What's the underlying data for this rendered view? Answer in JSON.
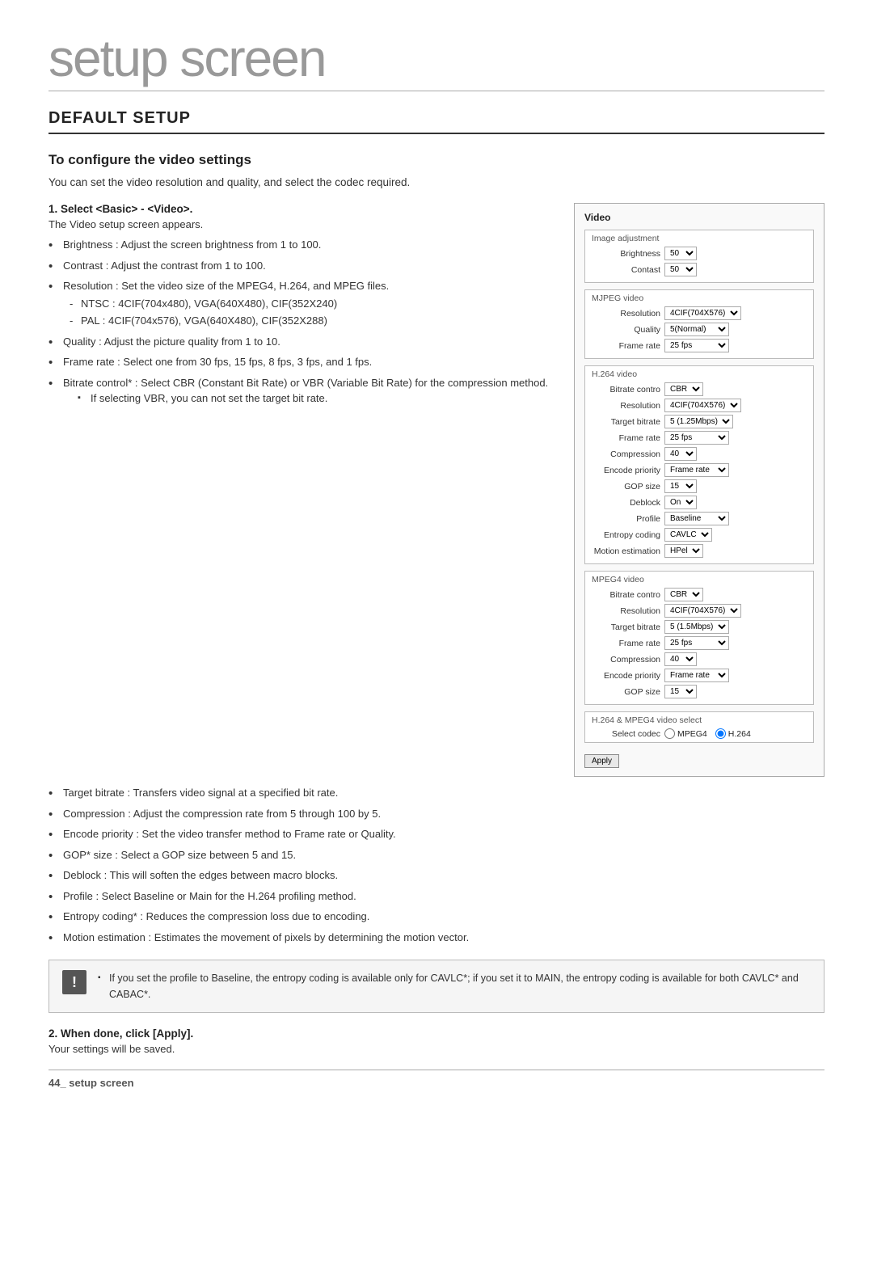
{
  "page": {
    "title": "setup screen",
    "section": "DEFAULT SETUP",
    "subheading": "To configure the video settings",
    "intro": "You can set the video resolution and quality, and select the codec required.",
    "footer": "44_ setup screen"
  },
  "step1": {
    "label": "Select <Basic> - <Video>.",
    "sub": "The Video setup screen appears.",
    "bullets": [
      "Brightness : Adjust the screen brightness from 1 to 100.",
      "Contrast : Adjust the contrast from 1 to 100.",
      "Resolution : Set the video size of the MPEG4, H.264, and MPEG files.",
      "Quality : Adjust the picture quality from 1 to 10.",
      "Frame rate : Select one from 30 fps, 15 fps, 8 fps, 3 fps, and 1 fps.",
      "Bitrate control* : Select CBR (Constant Bit Rate) or VBR (Variable Bit Rate) for the compression method.",
      "Target bitrate : Transfers video signal at a specified bit rate.",
      "Compression : Adjust the compression rate from 5 through 100 by 5.",
      "Encode priority :  Set the video transfer method to Frame rate or Quality.",
      "GOP* size : Select a GOP size between 5 and 15.",
      "Deblock : This will soften the edges between macro blocks.",
      "Profile : Select Baseline or Main for the H.264 profiling method.",
      "Entropy coding* : Reduces the compression loss due to encoding.",
      "Motion estimation : Estimates the movement of pixels by determining the motion vector."
    ],
    "resolution_sub": [
      "NTSC : 4CIF(704x480), VGA(640X480), CIF(352X240)",
      "PAL : 4CIF(704x576), VGA(640X480), CIF(352X288)"
    ],
    "vbr_note": "If selecting VBR, you can not set the target bit rate."
  },
  "video_panel": {
    "title": "Video",
    "groups": {
      "image_adjustment": {
        "label": "Image adjustment",
        "rows": [
          {
            "label": "Brightness",
            "value": "50"
          },
          {
            "label": "Contast",
            "value": "50"
          }
        ]
      },
      "mjpeg": {
        "label": "MJPEG video",
        "rows": [
          {
            "label": "Resolution",
            "value": "4CIF(704X576)"
          },
          {
            "label": "Quality",
            "value": "5(Normal)"
          },
          {
            "label": "Frame rate",
            "value": "25 fps"
          }
        ]
      },
      "h264": {
        "label": "H.264 video",
        "rows": [
          {
            "label": "Bitrate contro",
            "value": "CBR"
          },
          {
            "label": "Resolution",
            "value": "4CIF(704X576)"
          },
          {
            "label": "Target bitrate",
            "value": "5 (1.25Mbps)"
          },
          {
            "label": "Frame rate",
            "value": "25 fps"
          },
          {
            "label": "Compression",
            "value": "40"
          },
          {
            "label": "Encode priority",
            "value": "Frame rate"
          },
          {
            "label": "GOP size",
            "value": "15"
          },
          {
            "label": "Deblock",
            "value": "On"
          },
          {
            "label": "Profile",
            "value": "Baseline"
          },
          {
            "label": "Entropy coding",
            "value": "CAVLC"
          },
          {
            "label": "Motion estimation",
            "value": "HPel"
          }
        ]
      },
      "mpeg4": {
        "label": "MPEG4 video",
        "rows": [
          {
            "label": "Bitrate contro",
            "value": "CBR"
          },
          {
            "label": "Resolution",
            "value": "4CIF(704X576)"
          },
          {
            "label": "Target bitrate",
            "value": "5 (1.5Mbps)"
          },
          {
            "label": "Frame rate",
            "value": "25 fps"
          },
          {
            "label": "Compression",
            "value": "40"
          },
          {
            "label": "Encode priority",
            "value": "Frame rate"
          },
          {
            "label": "GOP size",
            "value": "15"
          }
        ]
      },
      "codec_select": {
        "label": "H.264 & MPEG4 video select",
        "label_text": "Select codec",
        "options": [
          "MPEG4",
          "H.264"
        ],
        "selected": "H.264"
      }
    },
    "apply_button": "Apply"
  },
  "warning": {
    "icon": "!",
    "text": "If you set the profile to Baseline, the entropy coding is available only for CAVLC*; if you set it to MAIN, the entropy coding is available for both CAVLC* and CABAC*."
  },
  "step2": {
    "label": "When done, click [Apply].",
    "sub": "Your settings will be saved."
  }
}
